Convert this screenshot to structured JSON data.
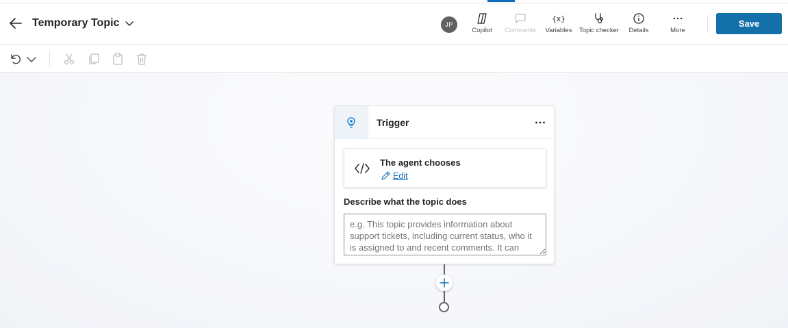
{
  "header": {
    "title": "Temporary Topic",
    "avatar_initials": "JP",
    "tools": {
      "copilot": "Copilot",
      "comments": "Comments",
      "variables": "Variables",
      "topic_checker": "Topic checker",
      "details": "Details",
      "more": "More"
    },
    "save_label": "Save"
  },
  "toolbar": {
    "icons": [
      "undo-icon",
      "chevron-down-icon",
      "cut-icon",
      "copy-icon",
      "paste-icon",
      "delete-icon"
    ]
  },
  "node": {
    "title": "Trigger",
    "agent_title": "The agent chooses",
    "edit_label": "Edit",
    "desc_label": "Describe what the topic does",
    "desc_placeholder": "e.g. This topic provides information about support tickets, including current status, who it is assigned to and recent comments. It can"
  },
  "colors": {
    "accent": "#0f6cbd",
    "save_button": "#1370a8",
    "trigger_icon": "#2b88d8"
  }
}
